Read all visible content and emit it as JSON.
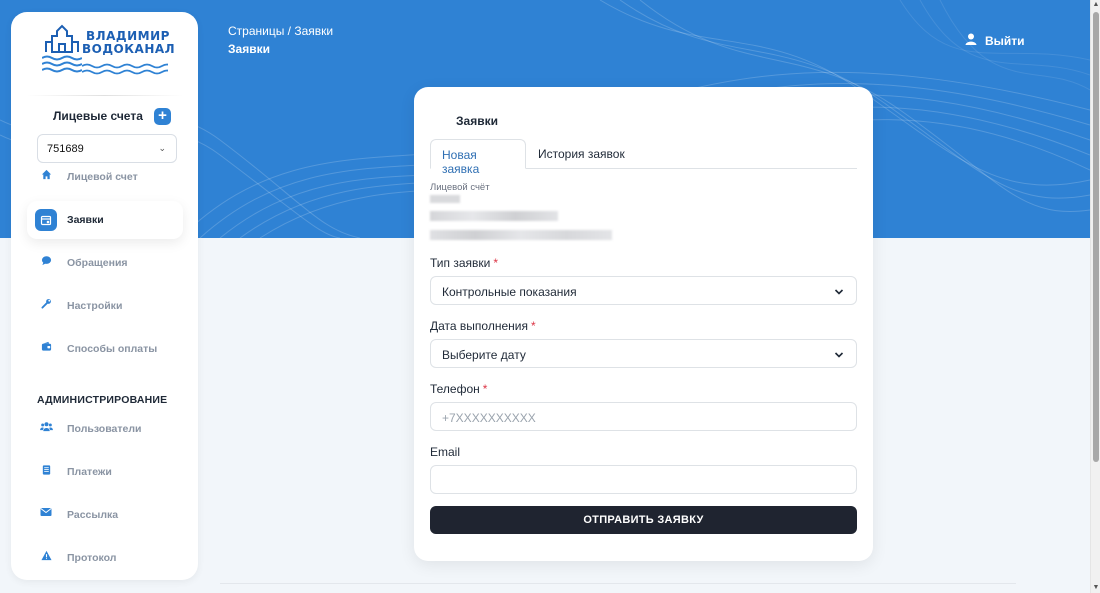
{
  "header": {
    "breadcrumb": "Страницы  /  Заявки",
    "page_title": "Заявки",
    "logout_label": "Выйти"
  },
  "sidebar": {
    "logo_line1": "ВЛАДИМИР",
    "logo_line2": "ВОДОКАНАЛ",
    "accounts_title": "Лицевые счета",
    "add_symbol": "+",
    "selected_account": "751689",
    "items": [
      {
        "label": "Лицевой счет",
        "icon": "home-icon"
      },
      {
        "label": "Заявки",
        "icon": "calendar-icon",
        "active": true
      },
      {
        "label": "Обращения",
        "icon": "chat-icon"
      },
      {
        "label": "Настройки",
        "icon": "wrench-icon"
      },
      {
        "label": "Способы оплаты",
        "icon": "wallet-icon"
      }
    ],
    "admin_title": "АДМИНИСТРИРОВАНИЕ",
    "admin_items": [
      {
        "label": "Пользователи",
        "icon": "users-icon"
      },
      {
        "label": "Платежи",
        "icon": "receipt-icon"
      },
      {
        "label": "Рассылка",
        "icon": "envelope-icon"
      },
      {
        "label": "Протокол",
        "icon": "warning-icon"
      }
    ]
  },
  "card": {
    "title": "Заявки",
    "tabs": [
      {
        "label": "Новая заявка",
        "active": true
      },
      {
        "label": "История заявок",
        "active": false
      }
    ],
    "account_label": "Лицевой счёт",
    "request_type_label": "Тип заявки",
    "request_type_value": "Контрольные показания",
    "date_label": "Дата выполнения",
    "date_value": "Выберите дату",
    "phone_label": "Телефон",
    "phone_placeholder": "+7XXXXXXXXXX",
    "email_label": "Email",
    "email_value": "",
    "required_mark": "*",
    "submit_label": "ОТПРАВИТЬ ЗАЯВКУ"
  },
  "colors": {
    "accent": "#2f82d4",
    "button_dark": "#1f2430",
    "required": "#dc3545"
  }
}
